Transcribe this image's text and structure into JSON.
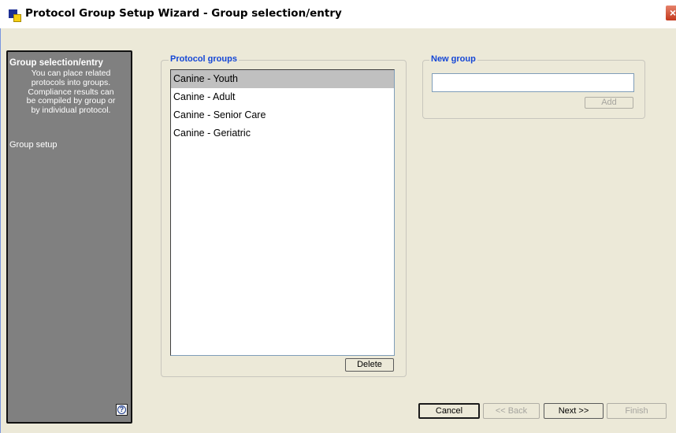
{
  "window": {
    "title": "Protocol Group Setup Wizard - Group selection/entry",
    "close_label": "×"
  },
  "sidebar": {
    "title": "Group selection/entry",
    "description": "You can place related\nprotocols into groups.\nCompliance results can\nbe compiled by group or\nby individual protocol.",
    "items": [
      "Group setup"
    ],
    "help_label": "?"
  },
  "protocol_groups": {
    "legend": "Protocol groups",
    "items": [
      "Canine - Youth",
      "Canine - Adult",
      "Canine - Senior Care",
      "Canine - Geriatric"
    ],
    "selected_index": 0,
    "delete_label": "Delete"
  },
  "new_group": {
    "legend": "New group",
    "value": "",
    "add_label": "Add"
  },
  "footer": {
    "cancel_label": "Cancel",
    "back_label": "<< Back",
    "next_label": "Next >>",
    "finish_label": "Finish"
  },
  "colors": {
    "legend_blue": "#1446d6",
    "sidebar_bg": "#808080",
    "window_bg": "#ECE9D8",
    "selected_item": "#c0c0c0"
  }
}
